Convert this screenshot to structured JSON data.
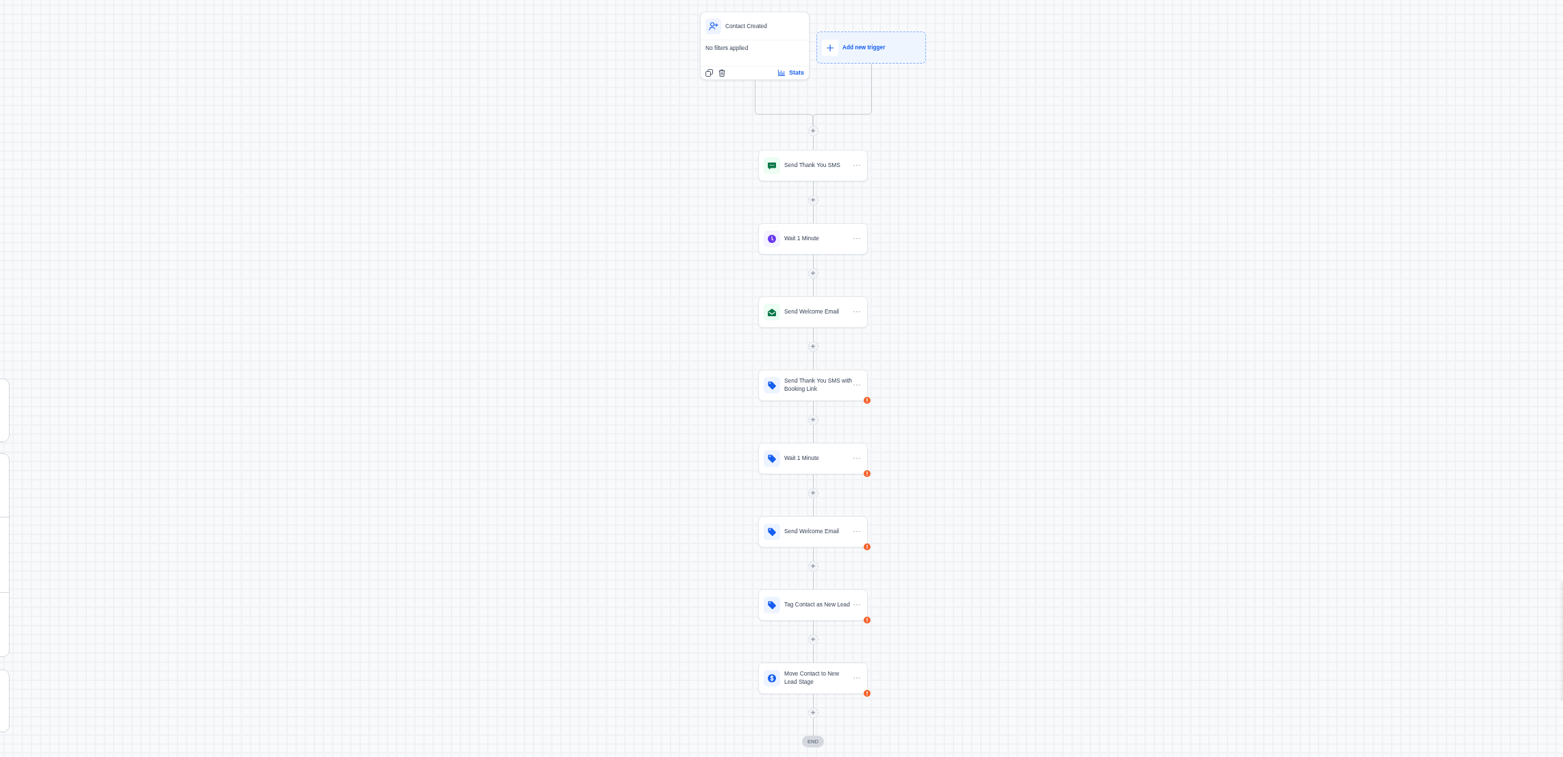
{
  "triggers": [
    {
      "kind": "contact_created",
      "title": "Contact Created",
      "filter_text": "No filters applied",
      "stats_label": "Stats"
    }
  ],
  "add_trigger": {
    "label": "Add new trigger"
  },
  "actions": [
    {
      "kind": "sms",
      "title": "Send Thank You SMS",
      "warning": false
    },
    {
      "kind": "wait",
      "title": "Wait 1 Minute",
      "warning": false
    },
    {
      "kind": "email",
      "title": "Send Welcome Email",
      "warning": false
    },
    {
      "kind": "tag",
      "title": "Send Thank You SMS with Booking Link",
      "warning": true
    },
    {
      "kind": "tag",
      "title": "Wait 1 Minute",
      "warning": true
    },
    {
      "kind": "tag",
      "title": "Send Welcome Email",
      "warning": true
    },
    {
      "kind": "tag",
      "title": "Tag Contact as New Lead",
      "warning": true
    },
    {
      "kind": "opportunity",
      "title": "Move Contact to New Lead Stage",
      "warning": true
    }
  ],
  "end": {
    "label": "END"
  }
}
